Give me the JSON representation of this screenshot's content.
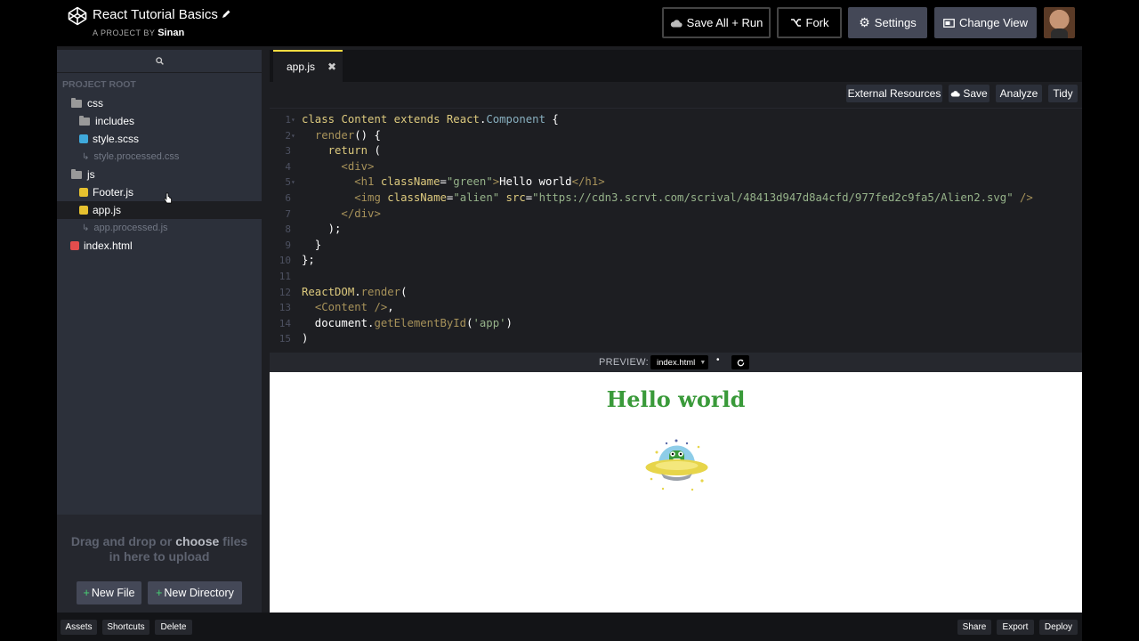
{
  "header": {
    "project_title": "React Tutorial Basics",
    "project_by_prefix": "A PROJECT BY",
    "author": "Sinan",
    "buttons": {
      "save_all_run": "Save All + Run",
      "fork": "Fork",
      "settings": "Settings",
      "change_view": "Change View"
    }
  },
  "sidebar": {
    "root_label": "PROJECT ROOT",
    "tree": [
      {
        "name": "css",
        "kind": "folder"
      },
      {
        "name": "includes",
        "kind": "folder"
      },
      {
        "name": "style.scss",
        "kind": "scss"
      },
      {
        "name": "style.processed.css",
        "kind": "processed"
      },
      {
        "name": "js",
        "kind": "folder"
      },
      {
        "name": "Footer.js",
        "kind": "js"
      },
      {
        "name": "app.js",
        "kind": "js"
      },
      {
        "name": "app.processed.js",
        "kind": "processed"
      },
      {
        "name": "index.html",
        "kind": "html"
      }
    ],
    "dropzone": {
      "line1_a": "Drag and drop or",
      "line1_hl": "choose",
      "line1_b": "files",
      "line2": "in here to upload"
    },
    "new_file": "New File",
    "new_directory": "New Directory"
  },
  "editor": {
    "active_tab": "app.js",
    "toolbar": {
      "external_resources": "External Resources",
      "save": "Save",
      "analyze": "Analyze",
      "tidy": "Tidy"
    },
    "code_lines": [
      "class Content extends React.Component {",
      "  render() {",
      "    return (",
      "      <div>",
      "        <h1 className=\"green\">Hello world</h1>",
      "        <img className=\"alien\" src=\"https://cdn3.scrvt.com/scrival/48413d947d8a4cfd/977fed2c9fa5/Alien2.svg\" />",
      "      </div>",
      "    );",
      "  }",
      "};",
      "",
      "ReactDOM.render(",
      "  <Content />,",
      "  document.getElementById('app')",
      ")"
    ]
  },
  "preview": {
    "label": "PREVIEW:",
    "file": "index.html",
    "heading": "Hello world",
    "heading_color": "#3a9a3a"
  },
  "footer": {
    "assets": "Assets",
    "shortcuts": "Shortcuts",
    "delete": "Delete",
    "share": "Share",
    "export": "Export",
    "deploy": "Deploy"
  },
  "colors": {
    "accent_tab": "#ffdd40",
    "plus_green": "#47cf73",
    "panel": "#2c303a",
    "editor_bg": "#1d1e22"
  }
}
